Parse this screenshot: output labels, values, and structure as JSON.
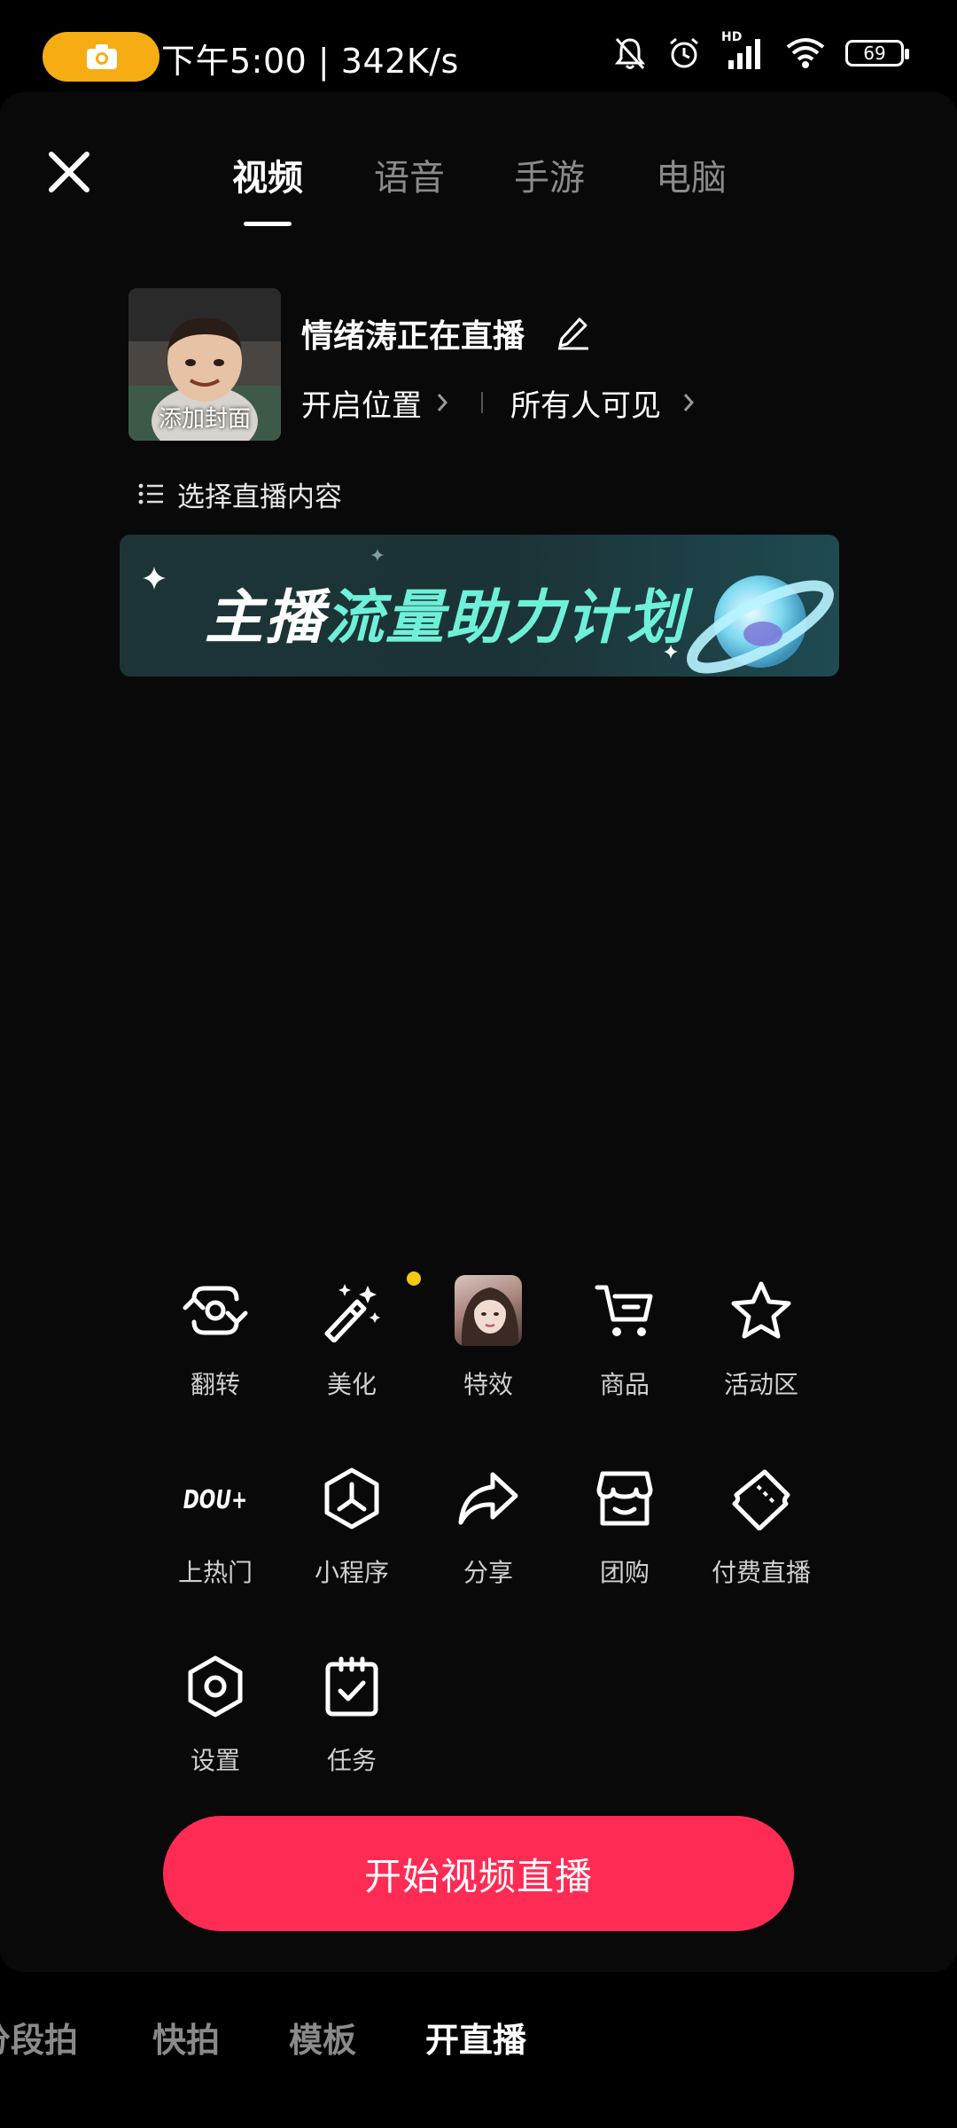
{
  "status_bar": {
    "time_speed": "下午5:00 | 342K/s",
    "battery": "69",
    "hd_label": "HD",
    "icons": [
      "camera-icon",
      "bell-mute-icon",
      "alarm-icon",
      "signal-icon",
      "wifi-icon",
      "battery-icon"
    ]
  },
  "tabs": [
    {
      "label": "视频",
      "active": true
    },
    {
      "label": "语音",
      "active": false
    },
    {
      "label": "手游",
      "active": false
    },
    {
      "label": "电脑",
      "active": false
    }
  ],
  "cover": {
    "label": "添加封面"
  },
  "live": {
    "title": "情绪涛正在直播",
    "location_label": "开启位置",
    "visibility_label": "所有人可见"
  },
  "select_content_label": "选择直播内容",
  "banner": {
    "text_white": "主播",
    "text_green": "流量助力计划"
  },
  "features": [
    {
      "label": "翻转",
      "icon": "flip-camera-icon"
    },
    {
      "label": "美化",
      "icon": "magic-wand-icon",
      "badge": true
    },
    {
      "label": "特效",
      "icon": "effect-thumbnail"
    },
    {
      "label": "商品",
      "icon": "cart-icon"
    },
    {
      "label": "活动区",
      "icon": "star-icon"
    },
    {
      "label": "上热门",
      "icon": "dou-plus-icon",
      "icon_text": "DOU+"
    },
    {
      "label": "小程序",
      "icon": "mini-program-icon"
    },
    {
      "label": "分享",
      "icon": "share-icon"
    },
    {
      "label": "团购",
      "icon": "store-icon"
    },
    {
      "label": "付费直播",
      "icon": "ticket-icon"
    },
    {
      "label": "设置",
      "icon": "settings-icon"
    },
    {
      "label": "任务",
      "icon": "task-clipboard-icon"
    }
  ],
  "start_button": {
    "label": "开始视频直播"
  },
  "bottom_nav": [
    {
      "label": "分段拍",
      "active": false
    },
    {
      "label": "快拍",
      "active": false
    },
    {
      "label": "模板",
      "active": false
    },
    {
      "label": "开直播",
      "active": true
    }
  ],
  "colors": {
    "accent": "#fe2c55",
    "banner_green": "#6ff0d8",
    "badge": "#f6c915",
    "camera_pill": "#f6ad13"
  }
}
